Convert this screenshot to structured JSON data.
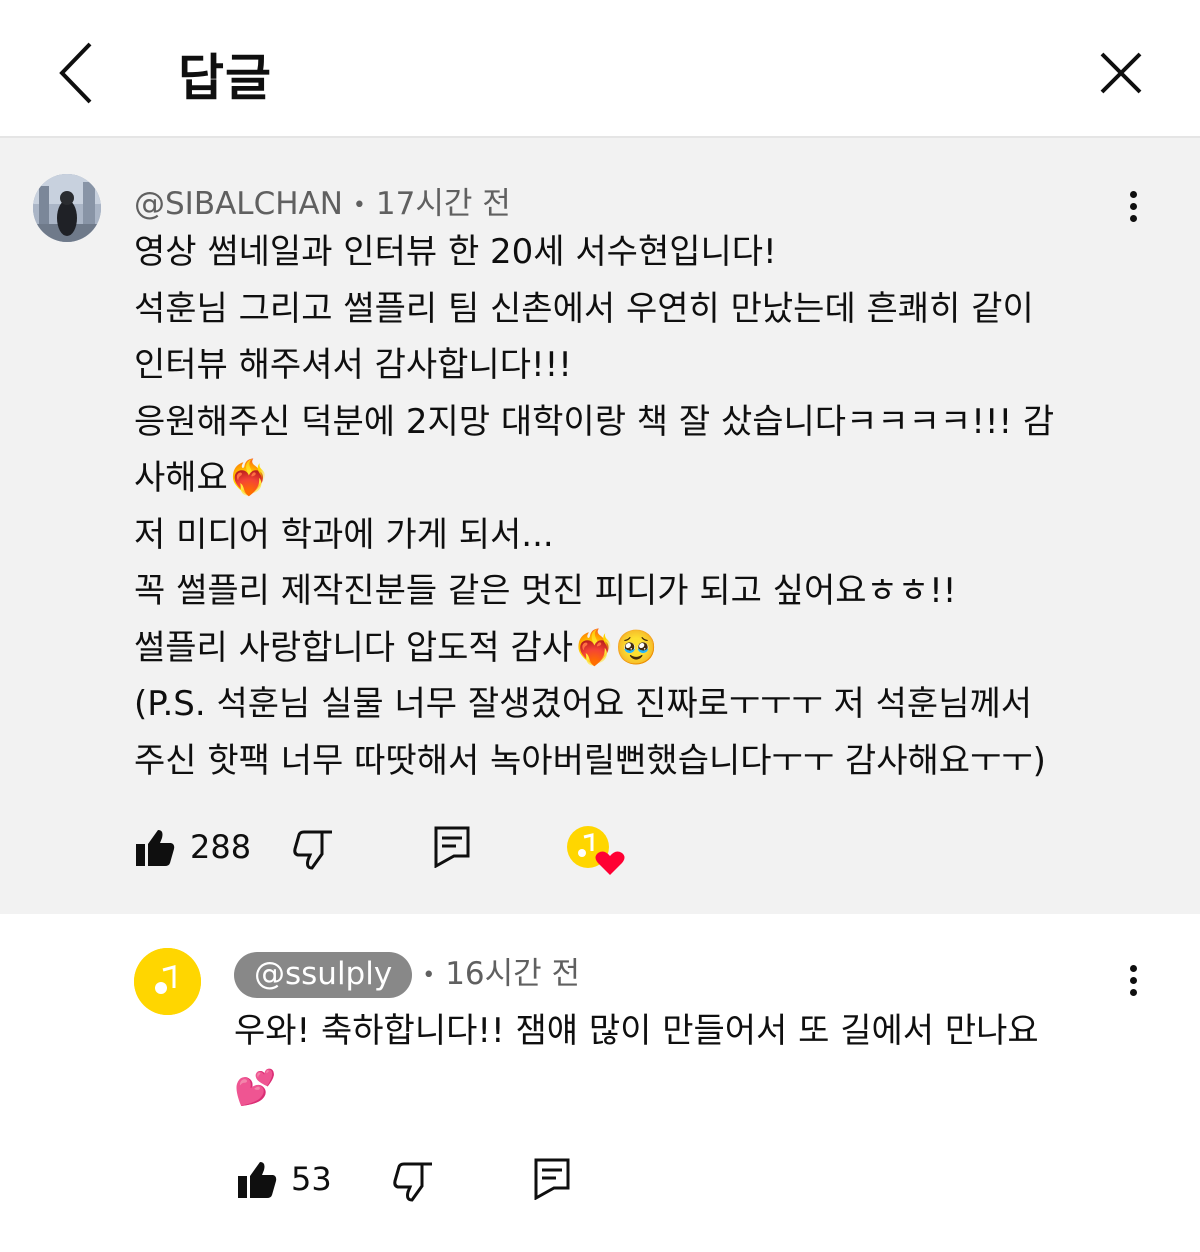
{
  "header": {
    "title": "답글"
  },
  "top_comment": {
    "handle": "@SIBALCHAN",
    "time": "17시간 전",
    "lines": [
      "영상 썸네일과 인터뷰 한 20세 서수현입니다!",
      "석훈님 그리고 썰플리 팀 신촌에서 우연히 만났는데 흔쾌히 같이",
      "인터뷰 해주셔서 감사합니다!!!",
      "응원해주신 덕분에 2지망 대학이랑 책 잘 샀습니다ㅋㅋㅋㅋ!!! 감",
      "사해요❤️‍🔥",
      "저 미디어 학과에 가게 되서...",
      "꼭 썰플리 제작진분들 같은 멋진 피디가 되고 싶어요ㅎㅎ!!",
      "썰플리 사랑합니다 압도적 감사❤️‍🔥🥹",
      "(P.S. 석훈님 실물 너무 잘생겼어요 진짜로ㅜㅜㅜ 저 석훈님께서",
      "주신 핫팩 너무 따땃해서 녹아버릴뻔했습니다ㅜㅜ 감사해요ㅜㅜ)"
    ],
    "likes": "288"
  },
  "reply": {
    "handle": "@ssulply",
    "time": "16시간 전",
    "lines": [
      "우와! 축하합니다!! 잼얘 많이 만들어서 또 길에서 만나요",
      "💕"
    ],
    "likes": "53"
  },
  "icons": {
    "back": "chevron-left-icon",
    "close": "close-icon",
    "more": "more-vertical-icon",
    "like": "thumbs-up-icon",
    "dislike": "thumbs-down-icon",
    "reply": "comment-icon",
    "creator_heart": "creator-heart-icon"
  },
  "colors": {
    "top_comment_bg": "#f2f2f2",
    "channel_avatar": "#ffd600",
    "heart": "#ff0033",
    "handle_chip": "#888888"
  }
}
